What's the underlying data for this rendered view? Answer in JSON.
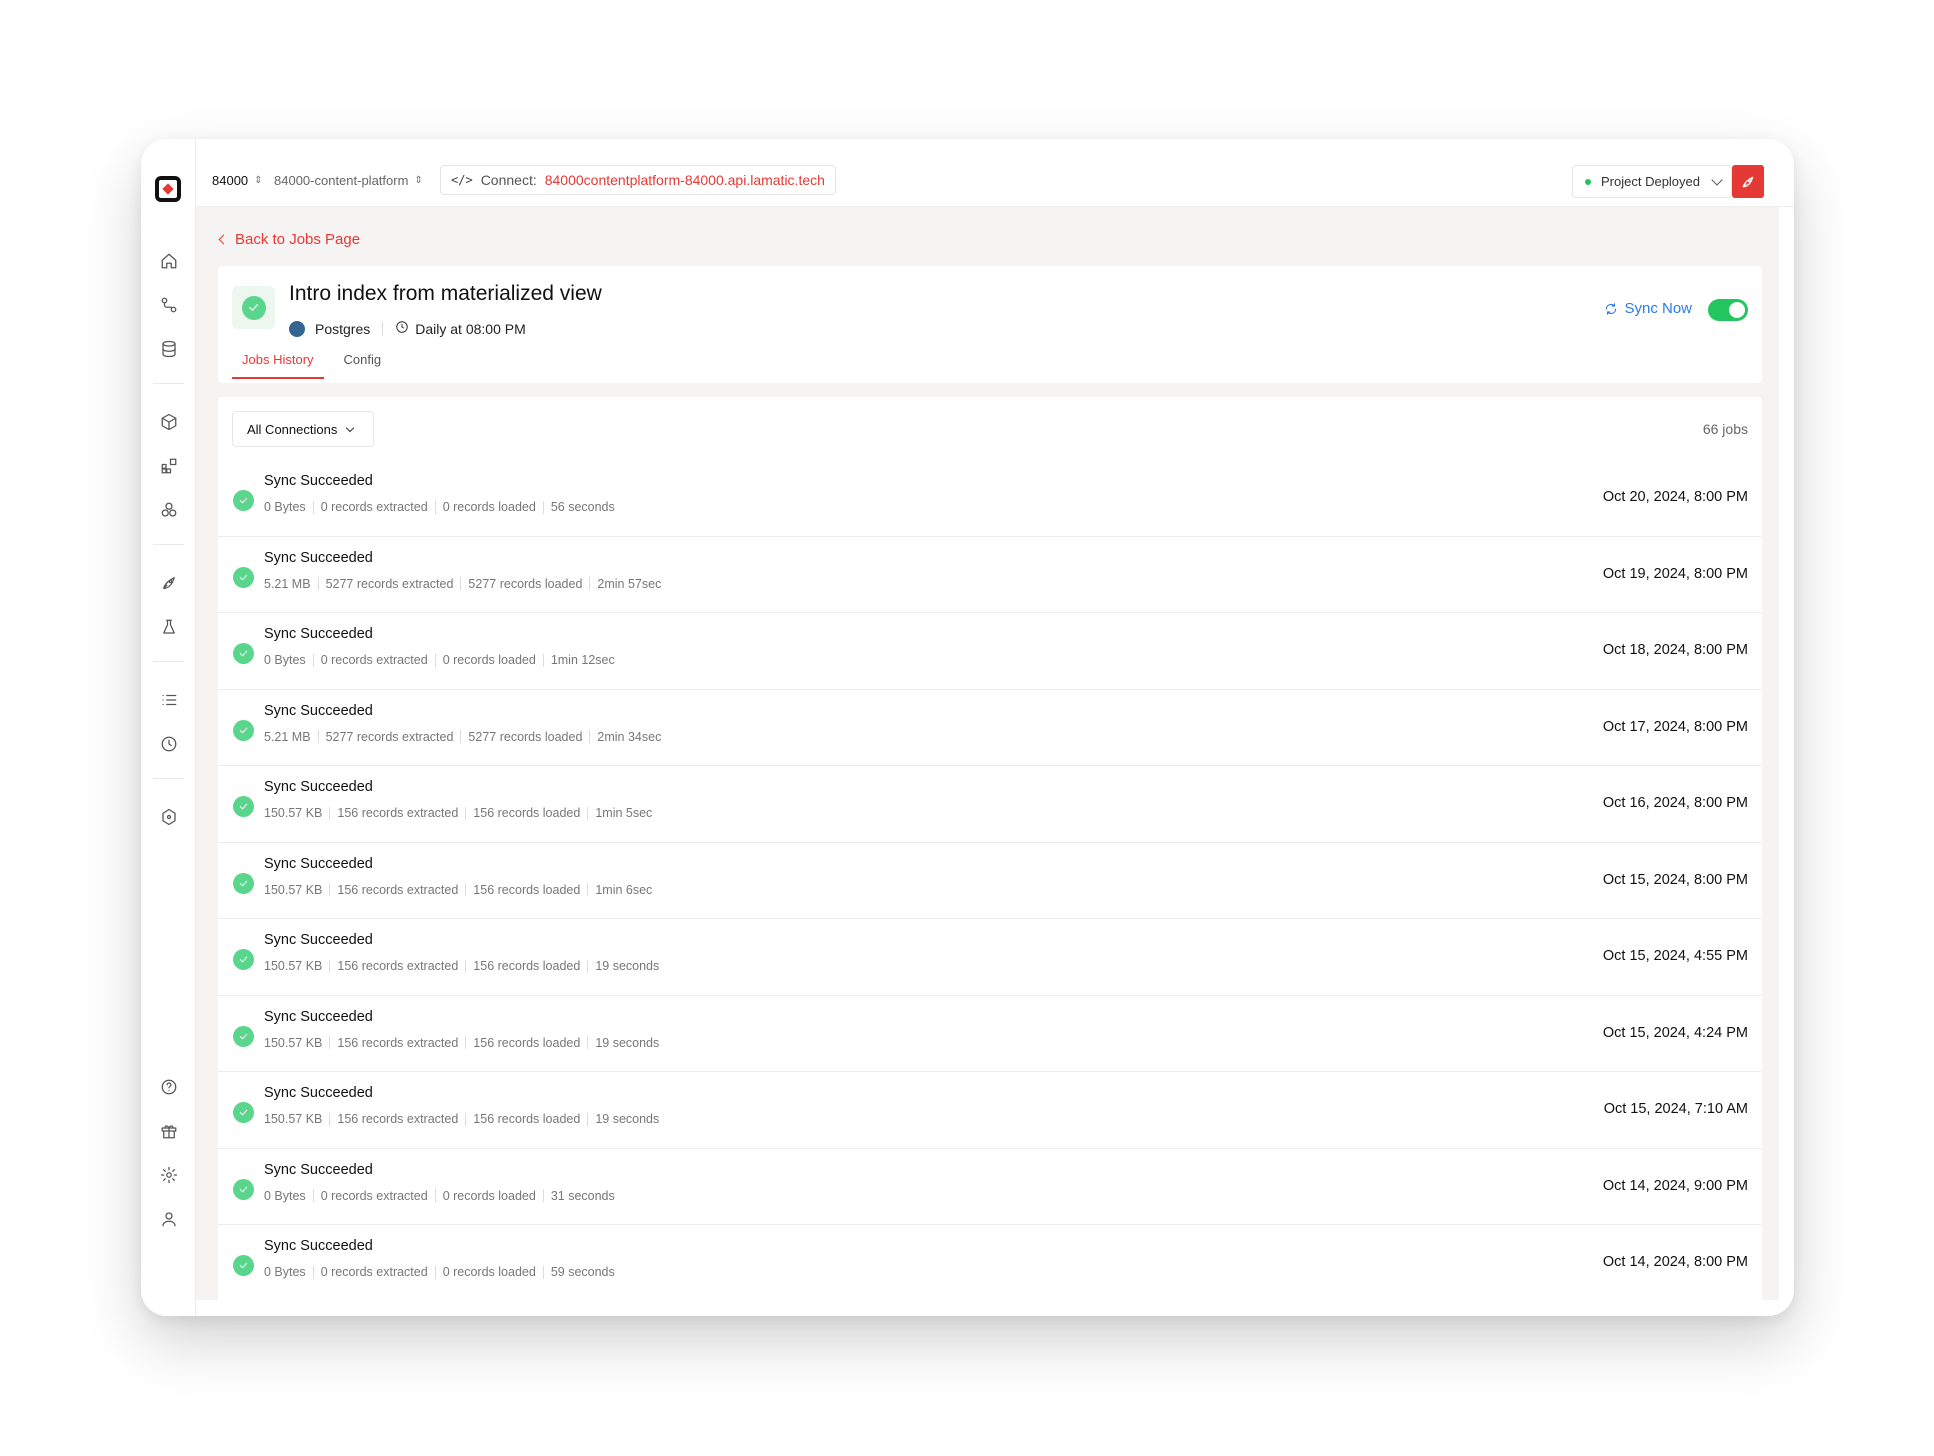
{
  "topbar": {
    "org": "84000",
    "project": "84000-content-platform",
    "connect_label": "Connect:",
    "connect_url": "84000contentplatform-84000.api.lamatic.tech",
    "status": "Project Deployed"
  },
  "back_link": "Back to Jobs Page",
  "job": {
    "title": "Intro index from materialized view",
    "source": "Postgres",
    "schedule": "Daily at 08:00 PM",
    "sync_now": "Sync Now",
    "enabled": true
  },
  "tabs": [
    "Jobs History",
    "Config"
  ],
  "filter_label": "All Connections",
  "job_count": "66 jobs",
  "rows": [
    {
      "status": "Sync Succeeded",
      "size": "0 Bytes",
      "extracted": "0 records extracted",
      "loaded": "0 records loaded",
      "duration": "56 seconds",
      "date": "Oct 20, 2024, 8:00 PM"
    },
    {
      "status": "Sync Succeeded",
      "size": "5.21 MB",
      "extracted": "5277 records extracted",
      "loaded": "5277 records loaded",
      "duration": "2min 57sec",
      "date": "Oct 19, 2024, 8:00 PM"
    },
    {
      "status": "Sync Succeeded",
      "size": "0 Bytes",
      "extracted": "0 records extracted",
      "loaded": "0 records loaded",
      "duration": "1min 12sec",
      "date": "Oct 18, 2024, 8:00 PM"
    },
    {
      "status": "Sync Succeeded",
      "size": "5.21 MB",
      "extracted": "5277 records extracted",
      "loaded": "5277 records loaded",
      "duration": "2min 34sec",
      "date": "Oct 17, 2024, 8:00 PM"
    },
    {
      "status": "Sync Succeeded",
      "size": "150.57 KB",
      "extracted": "156 records extracted",
      "loaded": "156 records loaded",
      "duration": "1min 5sec",
      "date": "Oct 16, 2024, 8:00 PM"
    },
    {
      "status": "Sync Succeeded",
      "size": "150.57 KB",
      "extracted": "156 records extracted",
      "loaded": "156 records loaded",
      "duration": "1min 6sec",
      "date": "Oct 15, 2024, 8:00 PM"
    },
    {
      "status": "Sync Succeeded",
      "size": "150.57 KB",
      "extracted": "156 records extracted",
      "loaded": "156 records loaded",
      "duration": "19 seconds",
      "date": "Oct 15, 2024, 4:55 PM"
    },
    {
      "status": "Sync Succeeded",
      "size": "150.57 KB",
      "extracted": "156 records extracted",
      "loaded": "156 records loaded",
      "duration": "19 seconds",
      "date": "Oct 15, 2024, 4:24 PM"
    },
    {
      "status": "Sync Succeeded",
      "size": "150.57 KB",
      "extracted": "156 records extracted",
      "loaded": "156 records loaded",
      "duration": "19 seconds",
      "date": "Oct 15, 2024, 7:10 AM"
    },
    {
      "status": "Sync Succeeded",
      "size": "0 Bytes",
      "extracted": "0 records extracted",
      "loaded": "0 records loaded",
      "duration": "31 seconds",
      "date": "Oct 14, 2024, 9:00 PM"
    },
    {
      "status": "Sync Succeeded",
      "size": "0 Bytes",
      "extracted": "0 records extracted",
      "loaded": "0 records loaded",
      "duration": "59 seconds",
      "date": "Oct 14, 2024, 8:00 PM"
    }
  ],
  "colors": {
    "accent": "#e53935",
    "success": "#5ad68c",
    "link": "#2b7be4",
    "toggle": "#22c55e"
  }
}
